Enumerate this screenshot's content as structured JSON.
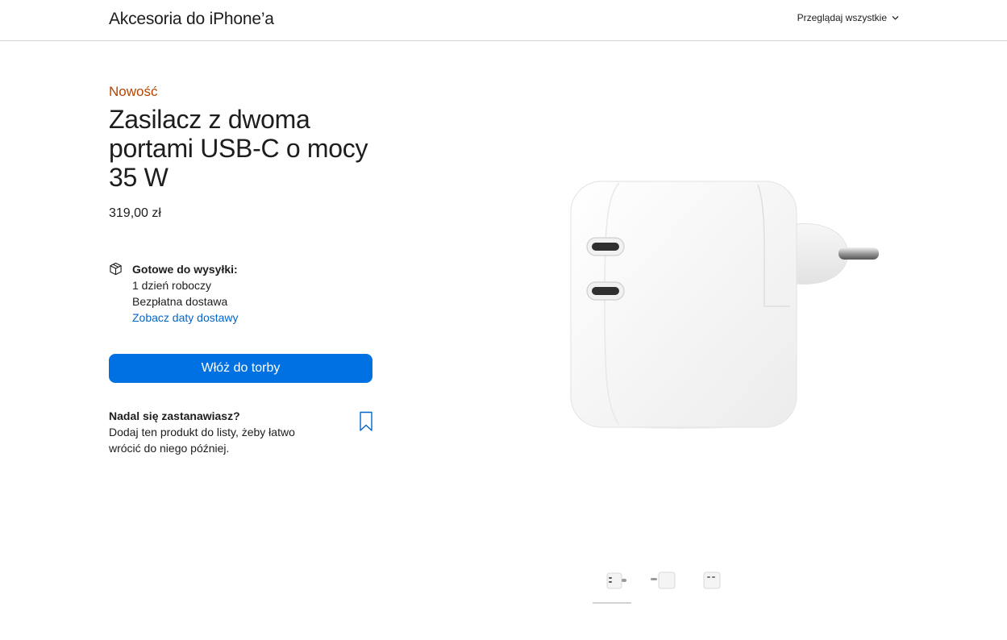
{
  "header": {
    "title": "Akcesoria do iPhone’a",
    "browse_label": "Przeglądaj wszystkie"
  },
  "product": {
    "badge": "Nowość",
    "title": "Zasilacz z dwoma portami USB-C o mocy 35 W",
    "price": "319,00 zł",
    "badge_color": "#b64400"
  },
  "delivery": {
    "heading": "Gotowe do wysyłki:",
    "line1": "1 dzień roboczy",
    "line2": "Bezpłatna dostawa",
    "link": "Zobacz daty dostawy"
  },
  "cart": {
    "button_label": "Włóż do torby",
    "button_color": "#0071e3"
  },
  "save_for_later": {
    "heading": "Nadal się zastanawiasz?",
    "text": "Dodaj ten produkt do listy, żeby łatwo wrócić do niego później."
  },
  "gallery": {
    "thumbnails": [
      "front-view",
      "side-view",
      "back-view"
    ],
    "active_index": 0
  },
  "icons": {
    "box": "box-icon",
    "bookmark": "bookmark-icon",
    "chevron": "chevron-down-icon"
  }
}
